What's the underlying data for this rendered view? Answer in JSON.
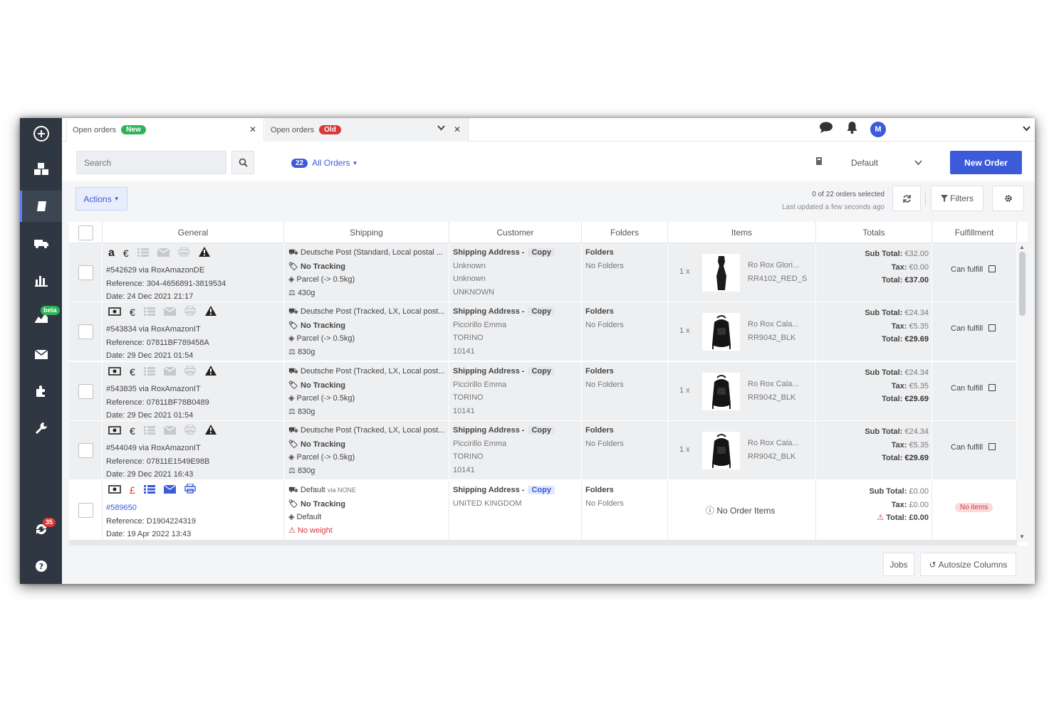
{
  "tabs": [
    {
      "label": "Open orders",
      "badge": "New",
      "badge_color": "#2fb35a"
    },
    {
      "label": "Open orders",
      "badge": "Old",
      "badge_color": "#d9383a"
    }
  ],
  "header": {
    "avatar_initial": "M"
  },
  "toolbar": {
    "search_placeholder": "Search",
    "orders_count": "22",
    "orders_filter": "All Orders",
    "view_name": "Default",
    "new_order_label": "New Order"
  },
  "toolbar2": {
    "actions_label": "Actions",
    "selected_text": "0 of 22 orders selected",
    "updated_text": "Last updated a few seconds ago",
    "filters_label": "Filters"
  },
  "sidebar": {
    "beta_badge": "beta",
    "notification_count": "35"
  },
  "columns": [
    "General",
    "Shipping",
    "Customer",
    "Folders",
    "Items",
    "Totals",
    "Fulfillment"
  ],
  "orders": [
    {
      "order": "#542629 via RoxAmazonDE",
      "reference_label": "Reference:",
      "reference": "304-4656891-3819534",
      "date_label": "Date:",
      "date": "24 Dec 2021 21:17",
      "currency": "€",
      "ship_service": "Deutsche Post (Standard, Local postal ...",
      "tracking": "No Tracking",
      "parcel": "Parcel (-> 0.5kg)",
      "weight": "430g",
      "address_label": "Shipping Address -",
      "copy": "Copy",
      "cust1": "Unknown",
      "cust2": "Unknown",
      "cust3": "UNKNOWN",
      "folders_label": "Folders",
      "folders": "No Folders",
      "qty": "1 x",
      "item_name": "Ro Rox Glori...",
      "sku": "RR4102_RED_S",
      "sub_label": "Sub Total:",
      "sub": "€32.00",
      "tax_label": "Tax:",
      "tax": "€0.00",
      "total_label": "Total:",
      "total": "€37.00",
      "fulfillment": "Can fulfill"
    },
    {
      "order": "#543834 via RoxAmazonIT",
      "reference_label": "Reference:",
      "reference": "07811BF789458A",
      "date_label": "Date:",
      "date": "29 Dec 2021 01:54",
      "currency": "€",
      "ship_service": "Deutsche Post (Tracked, LX, Local post...",
      "tracking": "No Tracking",
      "parcel": "Parcel (-> 0.5kg)",
      "weight": "830g",
      "address_label": "Shipping Address -",
      "copy": "Copy",
      "cust1": "Piccirillo Emma",
      "cust2": "TORINO",
      "cust3": "10141",
      "folders_label": "Folders",
      "folders": "No Folders",
      "qty": "1 x",
      "item_name": "Ro Rox Cala...",
      "sku": "RR9042_BLK",
      "sub_label": "Sub Total:",
      "sub": "€24.34",
      "tax_label": "Tax:",
      "tax": "€5.35",
      "total_label": "Total:",
      "total": "€29.69",
      "fulfillment": "Can fulfill"
    },
    {
      "order": "#543835 via RoxAmazonIT",
      "reference_label": "Reference:",
      "reference": "07811BF78B0489",
      "date_label": "Date:",
      "date": "29 Dec 2021 01:54",
      "currency": "€",
      "ship_service": "Deutsche Post (Tracked, LX, Local post...",
      "tracking": "No Tracking",
      "parcel": "Parcel (-> 0.5kg)",
      "weight": "830g",
      "address_label": "Shipping Address -",
      "copy": "Copy",
      "cust1": "Piccirillo Emma",
      "cust2": "TORINO",
      "cust3": "10141",
      "folders_label": "Folders",
      "folders": "No Folders",
      "qty": "1 x",
      "item_name": "Ro Rox Cala...",
      "sku": "RR9042_BLK",
      "sub_label": "Sub Total:",
      "sub": "€24.34",
      "tax_label": "Tax:",
      "tax": "€5.35",
      "total_label": "Total:",
      "total": "€29.69",
      "fulfillment": "Can fulfill"
    },
    {
      "order": "#544049 via RoxAmazonIT",
      "reference_label": "Reference:",
      "reference": "07811E1549E98B",
      "date_label": "Date:",
      "date": "29 Dec 2021 16:43",
      "currency": "€",
      "ship_service": "Deutsche Post (Tracked, LX, Local post...",
      "tracking": "No Tracking",
      "parcel": "Parcel (-> 0.5kg)",
      "weight": "830g",
      "address_label": "Shipping Address -",
      "copy": "Copy",
      "cust1": "Piccirillo Emma",
      "cust2": "TORINO",
      "cust3": "10141",
      "folders_label": "Folders",
      "folders": "No Folders",
      "qty": "1 x",
      "item_name": "Ro Rox Cala...",
      "sku": "RR9042_BLK",
      "sub_label": "Sub Total:",
      "sub": "€24.34",
      "tax_label": "Tax:",
      "tax": "€5.35",
      "total_label": "Total:",
      "total": "€29.69",
      "fulfillment": "Can fulfill"
    }
  ],
  "last_order": {
    "order": "#589650",
    "reference_label": "Reference:",
    "reference": "D1904224319",
    "date_label": "Date:",
    "date": "19 Apr 2022 13:43",
    "currency": "£",
    "ship_default": "Default",
    "ship_via": "via NONE",
    "tracking": "No Tracking",
    "parcel": "Default",
    "weight_warning": "No weight",
    "address_label": "Shipping Address -",
    "copy": "Copy",
    "cust1": "UNITED KINGDOM",
    "folders_label": "Folders",
    "folders": "No Folders",
    "no_items": "No Order Items",
    "sub_label": "Sub Total:",
    "sub": "£0.00",
    "tax_label": "Tax:",
    "tax": "£0.00",
    "total_label": "Total:",
    "total": "£0.00",
    "fulfillment": "No items"
  },
  "footer": {
    "jobs_label": "Jobs",
    "autosize_label": "Autosize Columns"
  },
  "colors": {
    "accent": "#3d5bd9",
    "sidebar": "#2f3742",
    "success": "#2fb35a",
    "danger": "#d9383a"
  }
}
